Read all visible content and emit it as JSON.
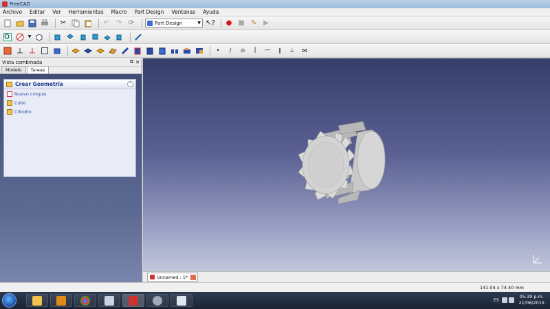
{
  "window": {
    "title": "FreeCAD"
  },
  "menu": [
    "Archivo",
    "Editar",
    "Ver",
    "Herramientas",
    "Macro",
    "Part Design",
    "Ventanas",
    "Ayuda"
  ],
  "workbench": {
    "selected": "Part Design"
  },
  "panel": {
    "title": "Vista combinada",
    "tabs": [
      "Modelo",
      "Tareas"
    ],
    "active_tab": "Tareas",
    "task": {
      "title": "Crear Geometría",
      "items": [
        "Nuevo croquis",
        "Cubo",
        "Cilindro"
      ]
    }
  },
  "document": {
    "tab": "Unnamed : 1*"
  },
  "status": {
    "coords": "141.04 x 74.40 mm"
  },
  "taskbar": {
    "lang": "ES",
    "time": "05:39 p.m.",
    "date": "21/08/2015"
  },
  "colors": {
    "viewport_top": "#383e6a",
    "viewport_bottom": "#c3c7dc",
    "accent": "#1f3f8f"
  }
}
